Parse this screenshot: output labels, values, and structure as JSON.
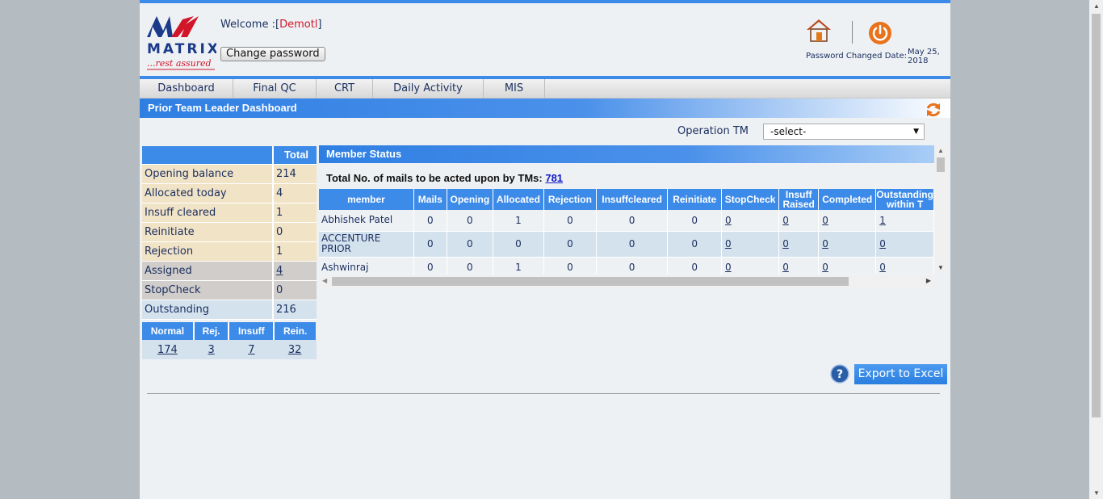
{
  "header": {
    "logo_text": "MATRIX",
    "logo_tagline": "...rest assured",
    "welcome_prefix": "Welcome :[",
    "welcome_user": "Demotl",
    "welcome_suffix": "]",
    "change_password_label": "Change password",
    "password_changed_label": "Password Changed Date:",
    "password_changed_value": "May 25, 2018"
  },
  "nav": {
    "items": [
      {
        "label": "Dashboard"
      },
      {
        "label": "Final QC"
      },
      {
        "label": "CRT"
      },
      {
        "label": "Daily Activity"
      },
      {
        "label": "MIS"
      }
    ]
  },
  "title": "Prior Team Leader Dashboard",
  "filter": {
    "label": "Operation TM",
    "selected": "-select-"
  },
  "summary": {
    "header": "Total",
    "rows": [
      {
        "label": "Opening balance",
        "value": "214"
      },
      {
        "label": "Allocated today",
        "value": "4"
      },
      {
        "label": "Insuff cleared",
        "value": "1"
      },
      {
        "label": "Reinitiate",
        "value": "0"
      },
      {
        "label": "Rejection",
        "value": "1"
      },
      {
        "label": "Assigned",
        "value": "4"
      },
      {
        "label": "StopCheck",
        "value": "0"
      },
      {
        "label": "Outstanding",
        "value": "216"
      }
    ],
    "breakdown_headers": [
      "Normal",
      "Rej.",
      "Insuff",
      "Rein."
    ],
    "breakdown_values": [
      "174",
      "3",
      "7",
      "32"
    ]
  },
  "member_status": {
    "title": "Member Status",
    "total_label": "Total No. of mails to be acted upon by TMs:",
    "total_value": "781",
    "columns": [
      "member",
      "Mails",
      "Opening",
      "Allocated",
      "Rejection",
      "Insuffcleared",
      "Reinitiate",
      "StopCheck",
      "Insuff Raised",
      "Completed",
      "Outstanding within T"
    ],
    "rows": [
      {
        "cells": [
          "Abhishek Patel",
          "0",
          "0",
          "1",
          "0",
          "0",
          "0",
          "0",
          "0",
          "0",
          "1"
        ]
      },
      {
        "cells": [
          "ACCENTURE PRIOR",
          "0",
          "0",
          "0",
          "0",
          "0",
          "0",
          "0",
          "0",
          "0",
          "0"
        ]
      },
      {
        "cells": [
          "Ashwinraj",
          "0",
          "0",
          "1",
          "0",
          "0",
          "0",
          "0",
          "0",
          "0",
          "0"
        ]
      }
    ]
  },
  "export_label": "Export to Excel",
  "colors": {
    "accent": "#3d8be8",
    "tan": "#f1e3c6",
    "gray": "#d1cdca",
    "light_blue": "#d4e2ee"
  }
}
